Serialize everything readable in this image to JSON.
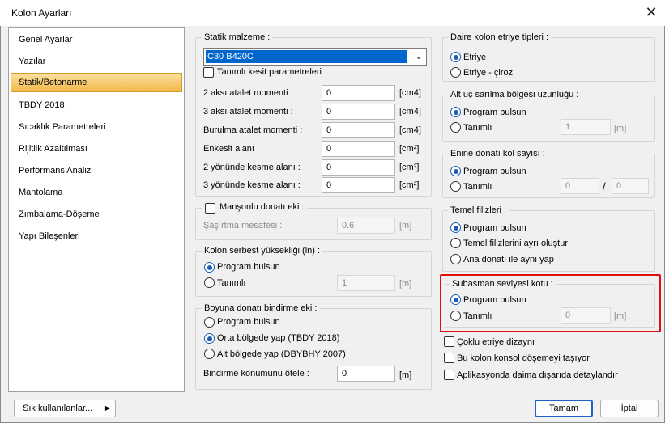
{
  "window": {
    "title": "Kolon Ayarları",
    "close_icon": "close-icon"
  },
  "nav": {
    "items": [
      "Genel Ayarlar",
      "Yazılar",
      "Statik/Betonarme",
      "TBDY 2018",
      "Sıcaklık Parametreleri",
      "Rijitlik Azaltılması",
      "Performans Analizi",
      "Mantolama",
      "Zımbalama-Döşeme",
      "Yapı Bileşenleri"
    ],
    "selected": "Statik/Betonarme"
  },
  "static": {
    "title": "Statik malzeme :",
    "material": "C30 B420C",
    "defined_section": "Tanımlı kesit parametreleri",
    "rows": [
      {
        "label": "2 aksı atalet momenti :",
        "value": "0",
        "unit": "[cm4]"
      },
      {
        "label": "3 aksı atalet momenti :",
        "value": "0",
        "unit": "[cm4]"
      },
      {
        "label": "Burulma atalet momenti :",
        "value": "0",
        "unit": "[cm4]"
      },
      {
        "label": "Enkesit alanı :",
        "value": "0",
        "unit": "[cm²]"
      },
      {
        "label": "2 yönünde kesme alanı :",
        "value": "0",
        "unit": "[cm²]"
      },
      {
        "label": "3 yönünde kesme alanı :",
        "value": "0",
        "unit": "[cm²]"
      }
    ]
  },
  "sleeve": {
    "title": "Manşonlu donatı eki :",
    "offset_label": "Şaşırtma mesafesi :",
    "offset_value": "0.6",
    "unit": "[m]"
  },
  "free_height": {
    "title": "Kolon serbest yüksekliği (ln) :",
    "opt_program": "Program bulsun",
    "opt_defined": "Tanımlı",
    "value": "1",
    "unit": "[m]"
  },
  "lap": {
    "title": "Boyuna donatı bindirme eki :",
    "opt1": "Program bulsun",
    "opt2": "Orta bölgede yap (TBDY 2018)",
    "opt3": "Alt bölgede yap (DBYBHY 2007)",
    "shift_label": "Bindirme konumunu ötele :",
    "shift_value": "0",
    "unit": "[m]"
  },
  "circular": {
    "title": "Daire kolon etriye tipleri :",
    "opt1": "Etriye",
    "opt2": "Etriye - çiroz"
  },
  "bottom_zone": {
    "title": "Alt uç sarılma bölgesi uzunluğu :",
    "opt1": "Program bulsun",
    "opt2": "Tanımlı",
    "value": "1",
    "unit": "[m]"
  },
  "transverse": {
    "title": "Enine donatı kol sayısı :",
    "opt1": "Program bulsun",
    "opt2": "Tanımlı",
    "value1": "0",
    "slash": "/",
    "value2": "0"
  },
  "foundation": {
    "title": "Temel filizleri :",
    "opt1": "Program bulsun",
    "opt2": "Temel filizlerini ayrı oluştur",
    "opt3": "Ana donatı ile aynı yap"
  },
  "basement": {
    "title": "Subasman seviyesi kotu  :",
    "opt1": "Program bulsun",
    "opt2": "Tanımlı",
    "value": "0",
    "unit": "[m]"
  },
  "checks": {
    "multi": "Çoklu etriye dizaynı",
    "console": "Bu kolon konsol döşemeyi taşıyor",
    "outside": "Aplikasyonda daima dışarıda detaylandır"
  },
  "footer": {
    "frequent": "Sık kullanılanlar...",
    "ok": "Tamam",
    "cancel": "İptal"
  }
}
